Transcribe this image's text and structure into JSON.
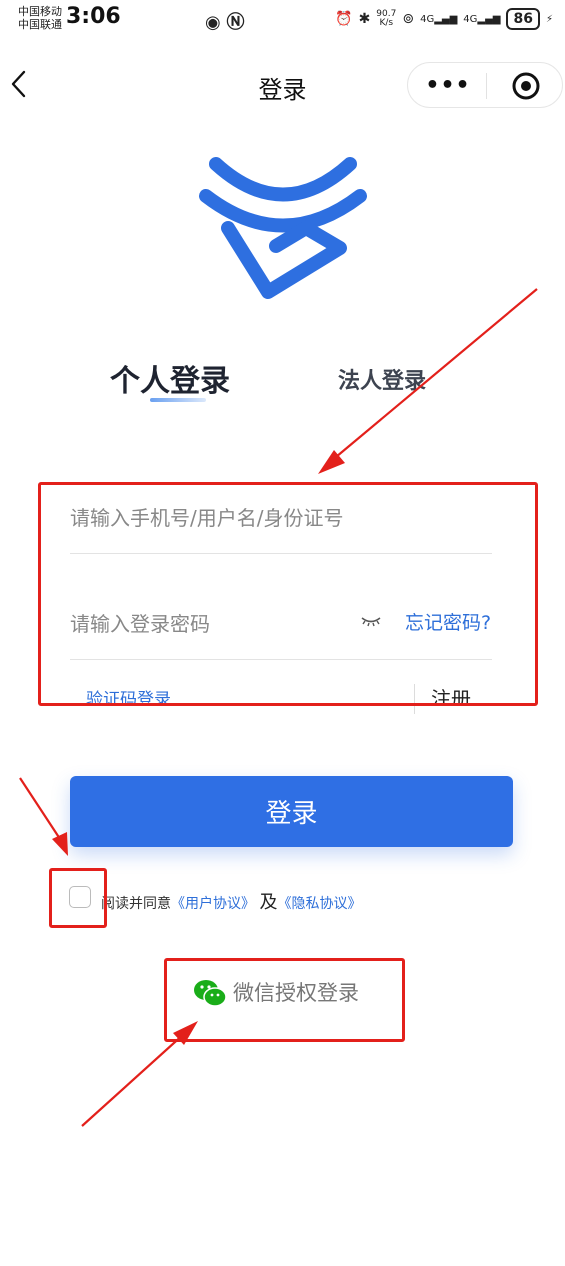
{
  "status_bar": {
    "carrier1": "中国移动",
    "carrier2": "中国联通",
    "time": "3:06",
    "speed_value": "90.7",
    "speed_unit": "K/s",
    "sig1": "4G",
    "sig2": "4G",
    "battery": "86"
  },
  "nav": {
    "title": "登录",
    "more_label": "•••"
  },
  "tabs": {
    "personal": "个人登录",
    "legal": "法人登录"
  },
  "form": {
    "username_placeholder": "请输入手机号/用户名/身份证号",
    "password_placeholder": "请输入登录密码",
    "forgot_password": "忘记密码?",
    "sms_login": "验证码登录",
    "register": "注册"
  },
  "login_button": "登录",
  "agreement": {
    "text": "阅读并同意",
    "user_agreement": "《用户协议》",
    "and": "及",
    "privacy_agreement": "《隐私协议》"
  },
  "wechat_login": "微信授权登录",
  "colors": {
    "primary": "#2f6fe4",
    "link": "#2e6fd9",
    "annotation": "#e3201b"
  }
}
